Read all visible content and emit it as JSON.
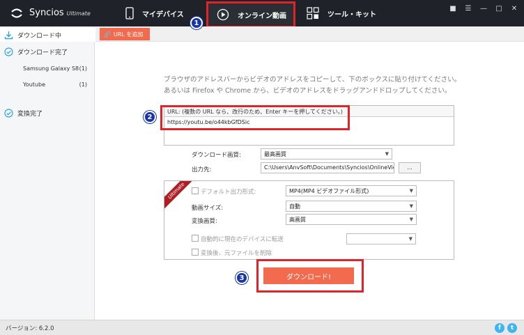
{
  "app": {
    "name": "Syncios",
    "edition": "Ultimate"
  },
  "nav": {
    "device_tab": "マイデバイス",
    "online_tab": "オンライン動画",
    "tools_tab": "ツール・キット"
  },
  "sidebar": {
    "downloading": "ダウンロード中",
    "download_complete": "ダウンロード完了",
    "sub_items": [
      {
        "label": "Samsung Galaxy S8",
        "count": "(1)"
      },
      {
        "label": "Youtube",
        "count": "(1)"
      }
    ],
    "convert_complete": "変換完了"
  },
  "toolbar": {
    "add_url": "URL を追加"
  },
  "main": {
    "instructions": "ブラウザのアドレスバーからビデオのアドレスをコピーして、下のボックスに貼り付けてください。あるいは Firefox や Chrome から、ビデオのアドレスをドラッグアンドドロップしてください。",
    "url_label": "URL: (複数の URL なら、改行のため、Enter キーを押してください。)",
    "url_value": "https://youtu.be/o44kbGfDSic",
    "quality_label": "ダウンロード画質:",
    "quality_value": "最高画質",
    "output_label": "出力先:",
    "output_value": "C:\\Users\\AnvSoft\\Documents\\Syncios\\OnlineVideo",
    "browse": "...",
    "ultimate_ribbon": "Ultimate",
    "default_format_label": "デフォルト出力形式:",
    "default_format_value": "MP4(MP4 ビデオファイル形式)",
    "video_size_label": "動画サイズ:",
    "video_size_value": "自動",
    "convert_quality_label": "変換画質:",
    "convert_quality_value": "高画質",
    "auto_transfer_label": "自動的に現在のデバイスに転送",
    "delete_after_label": "変換後、元ファイルを削除",
    "download_button": "ダウンロード!"
  },
  "markers": [
    "1",
    "2",
    "3"
  ],
  "status": {
    "version": "バージョン: 6.2.0"
  },
  "colors": {
    "titlebar": "#1f2228",
    "accent": "#f26b4e",
    "callout": "#e0242a",
    "marker": "#1836a8"
  }
}
